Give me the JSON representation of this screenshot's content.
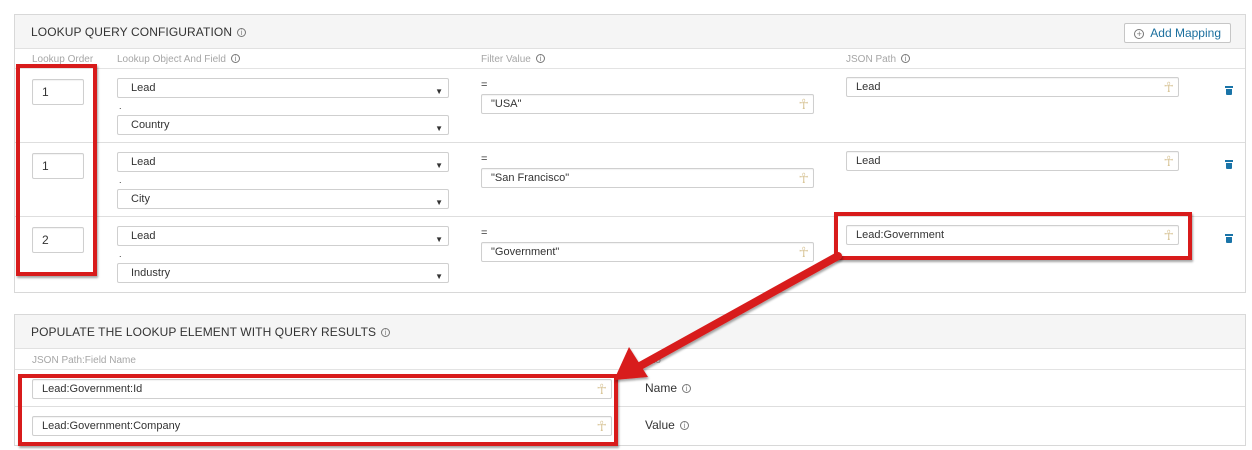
{
  "lookup": {
    "title": "LOOKUP QUERY CONFIGURATION",
    "add_mapping_label": "Add Mapping",
    "add_icon": "+",
    "info_icon": "i",
    "columns": {
      "order": "Lookup Order",
      "object_field": "Lookup Object And Field",
      "filter": "Filter Value",
      "json_path": "JSON Path"
    },
    "rows": [
      {
        "order": "1",
        "object": "Lead",
        "field": "Country",
        "separator": ".",
        "operator": "=",
        "filter": "\"USA\"",
        "json_path": "Lead"
      },
      {
        "order": "1",
        "object": "Lead",
        "field": "City",
        "separator": ".",
        "operator": "=",
        "filter": "\"San Francisco\"",
        "json_path": "Lead"
      },
      {
        "order": "2",
        "object": "Lead",
        "field": "Industry",
        "separator": ".",
        "operator": "=",
        "filter": "\"Government\"",
        "json_path": "Lead:Government"
      }
    ],
    "caret_icon": "▼",
    "key_icon": "☥"
  },
  "populate": {
    "title": "POPULATE THE LOOKUP ELEMENT WITH QUERY RESULTS",
    "columns": {
      "json_path": "JSON Path:Field Name",
      "into": "nto"
    },
    "rows": [
      {
        "json_path": "Lead:Government:Id",
        "target": "Name"
      },
      {
        "json_path": "Lead:Government:Company",
        "target": "Value"
      }
    ]
  },
  "colors": {
    "annotation_red": "#d81b1b",
    "link_blue": "#1b6f9e"
  }
}
